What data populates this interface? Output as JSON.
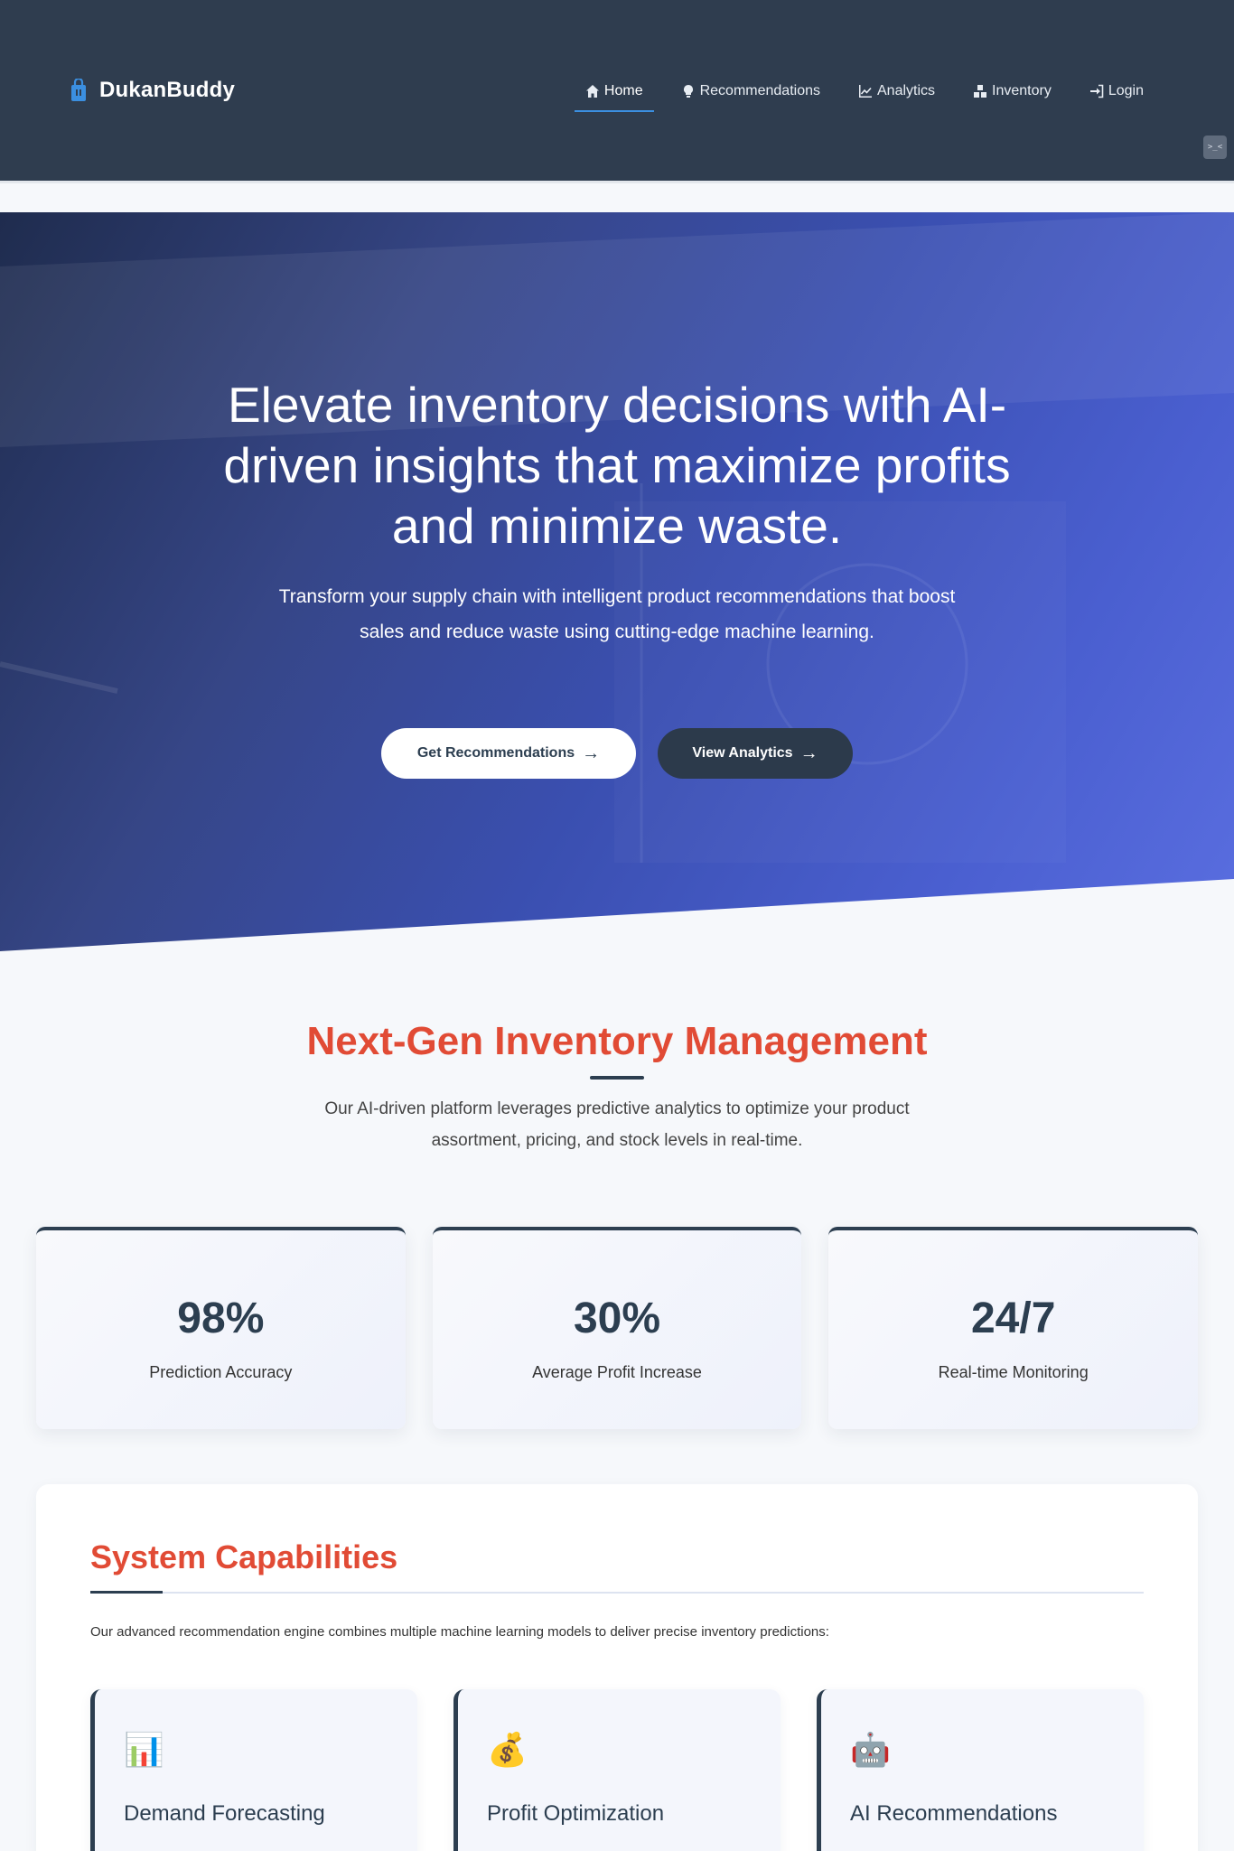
{
  "brand": {
    "name": "DukanBuddy"
  },
  "nav": {
    "items": [
      {
        "label": "Home",
        "icon": "home-icon",
        "active": true
      },
      {
        "label": "Recommendations",
        "icon": "lightbulb-icon"
      },
      {
        "label": "Analytics",
        "icon": "chart-line-icon"
      },
      {
        "label": "Inventory",
        "icon": "boxes-icon"
      },
      {
        "label": "Login",
        "icon": "sign-in-icon"
      }
    ]
  },
  "hero": {
    "title": "Elevate inventory decisions with AI-driven insights that maximize profits and minimize waste.",
    "subtitle": "Transform your supply chain with intelligent product recommendations that boost sales and reduce waste using cutting-edge machine learning.",
    "primary_button": "Get Recommendations",
    "secondary_button": "View Analytics",
    "arrow": "→"
  },
  "section": {
    "title": "Next-Gen Inventory Management",
    "description": "Our AI-driven platform leverages predictive analytics to optimize your product assortment, pricing, and stock levels in real-time."
  },
  "stats": [
    {
      "value": "98%",
      "label": "Prediction Accuracy"
    },
    {
      "value": "30%",
      "label": "Average Profit Increase"
    },
    {
      "value": "24/7",
      "label": "Real-time Monitoring"
    }
  ],
  "capabilities": {
    "title": "System Capabilities",
    "description": "Our advanced recommendation engine combines multiple machine learning models to deliver precise inventory predictions:",
    "cards": [
      {
        "icon": "📊",
        "title": "Demand Forecasting"
      },
      {
        "icon": "💰",
        "title": "Profit Optimization"
      },
      {
        "icon": "🤖",
        "title": "AI Recommendations"
      }
    ]
  },
  "colors": {
    "navbar": "#2f3d4f",
    "accent_red": "#e14b35",
    "dark": "#2c3e50",
    "active_underline": "#3b8fe0"
  }
}
